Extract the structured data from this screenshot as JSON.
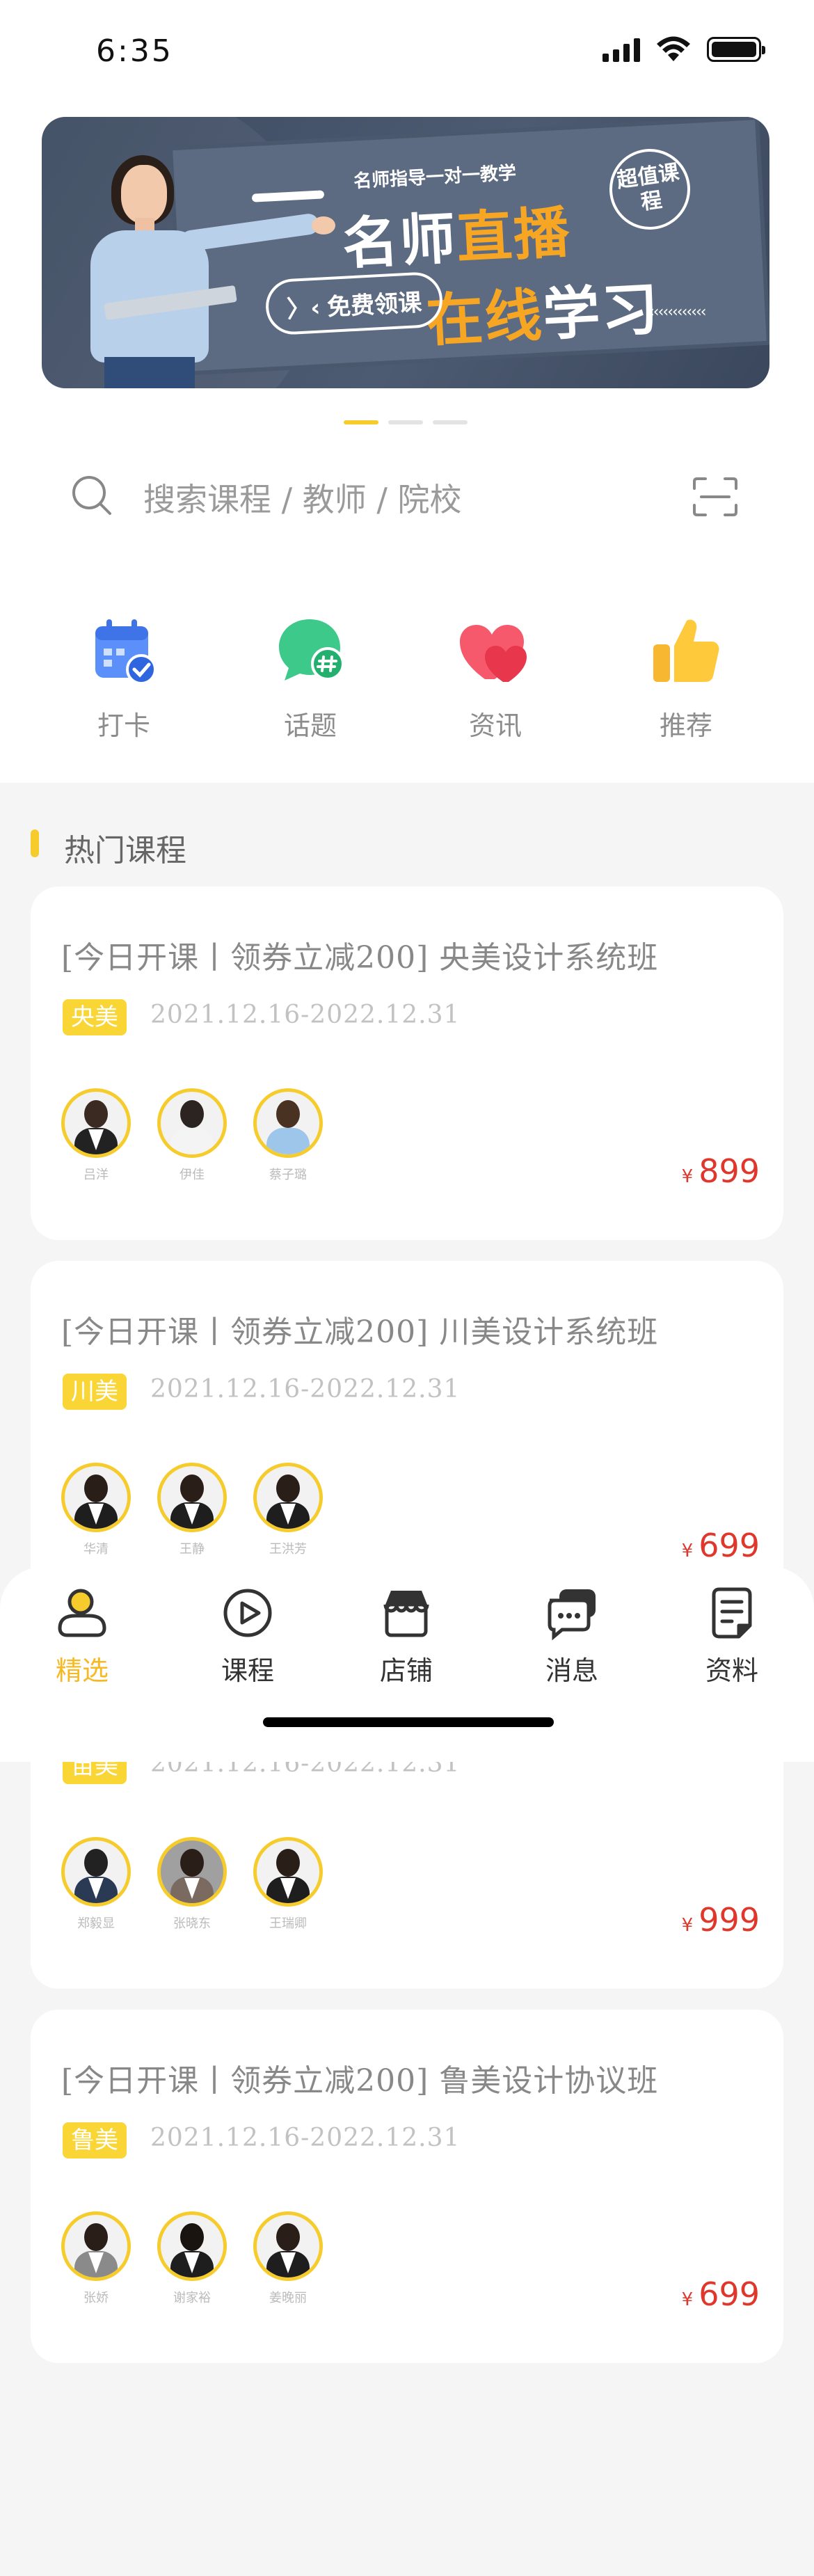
{
  "status_bar": {
    "time": "6:35"
  },
  "banner": {
    "subtitle": "名师指导一对一教学",
    "title_line1_white": "名师",
    "title_line1_accent": "直播",
    "title_line2_accent": "在线",
    "title_line2_white": "学习",
    "cta": "免费领课",
    "badge": "超值课程",
    "arrows": "‹‹‹‹‹‹‹‹‹‹‹‹"
  },
  "carousel": {
    "count": 3,
    "active": 0
  },
  "search": {
    "placeholder": "搜索课程 / 教师 / 院校"
  },
  "quick_actions": [
    {
      "label": "打卡",
      "icon": "calendar-check-icon"
    },
    {
      "label": "话题",
      "icon": "chat-hash-icon"
    },
    {
      "label": "资讯",
      "icon": "hearts-icon"
    },
    {
      "label": "推荐",
      "icon": "thumbs-up-icon"
    }
  ],
  "section": {
    "title": "热门课程"
  },
  "courses": [
    {
      "title": "[今日开课丨领券立减200]  央美设计系统班",
      "tag": "央美",
      "date": "2021.12.16-2022.12.31",
      "teachers": [
        "吕洋",
        "伊佳",
        "蔡子璐"
      ],
      "currency": "¥",
      "price": "899"
    },
    {
      "title": "[今日开课丨领券立减200]  川美设计系统班",
      "tag": "川美",
      "date": "2021.12.16-2022.12.31",
      "teachers": [
        "华清",
        "王静",
        "王洪芳"
      ],
      "currency": "¥",
      "price": "699"
    },
    {
      "title": "",
      "tag": "苗美",
      "date": "2021.12.16-2022.12.31",
      "teachers": [
        "郑毅显",
        "张晓东",
        "王瑞卿"
      ],
      "currency": "¥",
      "price": "999"
    },
    {
      "title": "[今日开课丨领券立减200]  鲁美设计协议班",
      "tag": "鲁美",
      "date": "2021.12.16-2022.12.31",
      "teachers": [
        "张娇",
        "谢家裕",
        "姜晚丽"
      ],
      "currency": "¥",
      "price": "699"
    }
  ],
  "bottom_nav": [
    {
      "label": "精选",
      "icon": "person-icon",
      "active": true
    },
    {
      "label": "课程",
      "icon": "play-circle-icon",
      "active": false
    },
    {
      "label": "店铺",
      "icon": "store-icon",
      "active": false
    },
    {
      "label": "消息",
      "icon": "message-icon",
      "active": false
    },
    {
      "label": "资料",
      "icon": "document-icon",
      "active": false
    }
  ],
  "colors": {
    "accent": "#f6cc2d",
    "price": "#e0372c",
    "banner_orange": "#f6a623",
    "background": "#f5f5f5"
  }
}
